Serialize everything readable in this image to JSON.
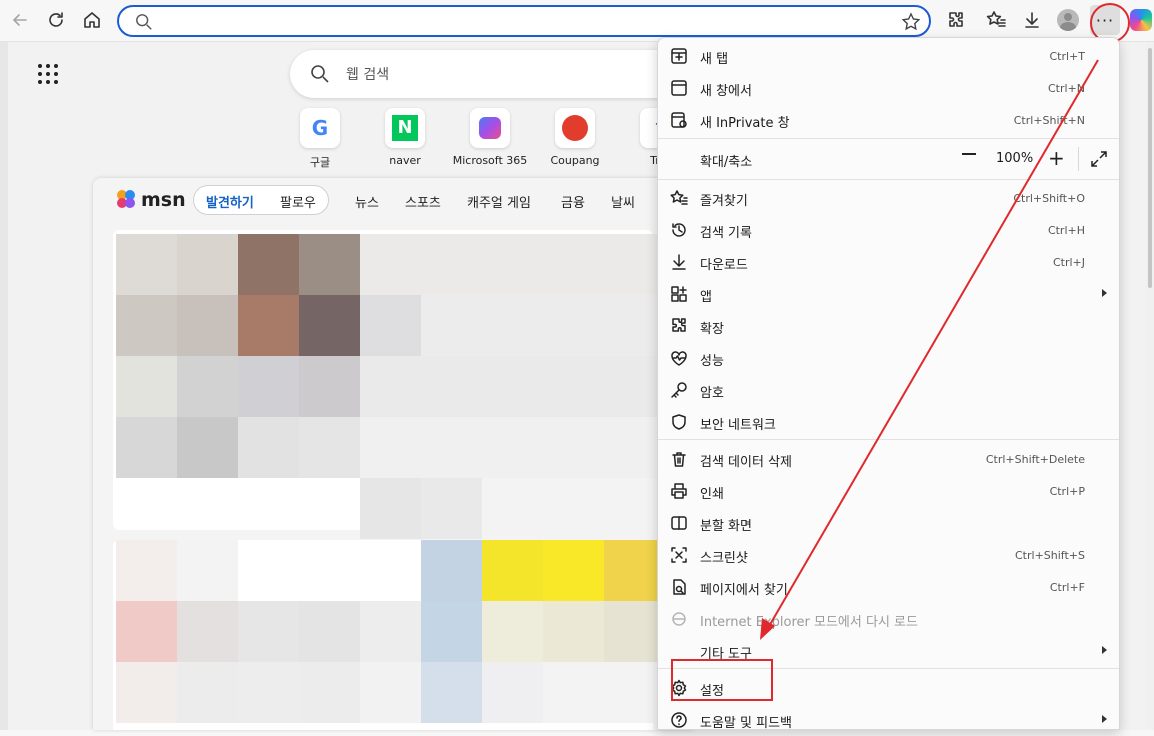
{
  "browser": {
    "address_value": "",
    "more_label": "···"
  },
  "newtab": {
    "search_placeholder": "웹 검색",
    "tiles": [
      {
        "label": "구글",
        "glyph": "G",
        "color": "#4285f4"
      },
      {
        "label": "naver",
        "glyph": "N",
        "color": "#03c75a"
      },
      {
        "label": "Microsoft 365",
        "glyph": "◆",
        "color": "#7b5cf0"
      },
      {
        "label": "Coupang",
        "glyph": "●",
        "color": "#e23c2c"
      },
      {
        "label": "Trip",
        "glyph": "T",
        "color": "#2f74d0"
      }
    ]
  },
  "msn": {
    "logo": "msn",
    "pill_active": "발견하기",
    "pill_other": "팔로우",
    "nav": [
      "뉴스",
      "스포츠",
      "캐주얼 게임",
      "금융",
      "날씨"
    ]
  },
  "menu": {
    "items": [
      {
        "label": "새 탭",
        "shortcut": "Ctrl+T",
        "icon": "new-tab-icon"
      },
      {
        "label": "새 창에서",
        "shortcut": "Ctrl+N",
        "icon": "new-window-icon"
      },
      {
        "label": "새 InPrivate 창",
        "shortcut": "Ctrl+Shift+N",
        "icon": "inprivate-icon"
      },
      {
        "label": "확대/축소",
        "zoom": "100%"
      },
      {
        "label": "즐겨찾기",
        "shortcut": "Ctrl+Shift+O",
        "icon": "favorites-icon"
      },
      {
        "label": "검색 기록",
        "shortcut": "Ctrl+H",
        "icon": "history-icon"
      },
      {
        "label": "다운로드",
        "shortcut": "Ctrl+J",
        "icon": "download-icon"
      },
      {
        "label": "앱",
        "icon": "apps-icon"
      },
      {
        "label": "확장",
        "icon": "extensions-icon"
      },
      {
        "label": "성능",
        "icon": "performance-icon"
      },
      {
        "label": "암호",
        "icon": "key-icon"
      },
      {
        "label": "보안 네트워크",
        "icon": "shield-icon"
      },
      {
        "label": "검색 데이터 삭제",
        "shortcut": "Ctrl+Shift+Delete",
        "icon": "trash-icon"
      },
      {
        "label": "인쇄",
        "shortcut": "Ctrl+P",
        "icon": "print-icon"
      },
      {
        "label": "분할 화면",
        "icon": "split-screen-icon"
      },
      {
        "label": "스크린샷",
        "shortcut": "Ctrl+Shift+S",
        "icon": "screenshot-icon"
      },
      {
        "label": "페이지에서 찾기",
        "shortcut": "Ctrl+F",
        "icon": "find-icon"
      },
      {
        "label": "Internet Explorer 모드에서 다시 로드",
        "icon": "ie-icon"
      },
      {
        "label": "기타 도구"
      },
      {
        "label": "설정",
        "icon": "gear-icon"
      },
      {
        "label": "도움말 및 피드백",
        "icon": "help-icon"
      }
    ]
  },
  "colors": {
    "accent": "#1c5bd6",
    "annotation_red": "#e0292d"
  }
}
